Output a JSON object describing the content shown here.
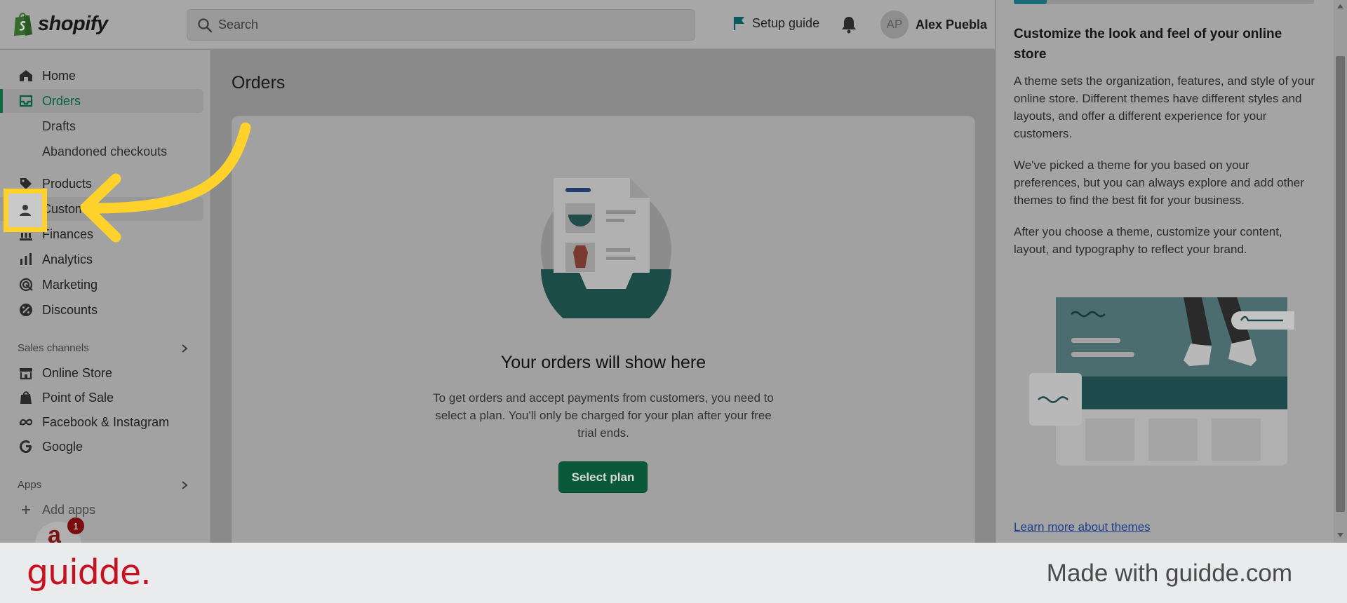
{
  "topbar": {
    "brand": "shopify",
    "search_placeholder": "Search",
    "setup_guide": "Setup guide",
    "avatar_initials": "AP",
    "user_name": "Alex Puebla"
  },
  "sidebar": {
    "items": [
      {
        "label": "Home",
        "icon": "home-icon"
      },
      {
        "label": "Orders",
        "icon": "inbox-icon",
        "active": true
      },
      {
        "label": "Drafts",
        "sub": true
      },
      {
        "label": "Abandoned checkouts",
        "sub": true
      },
      {
        "label": "Products",
        "icon": "tag-icon"
      },
      {
        "label": "Customers",
        "icon": "person-icon"
      },
      {
        "label": "Finances",
        "icon": "bank-icon"
      },
      {
        "label": "Analytics",
        "icon": "bar-chart-icon"
      },
      {
        "label": "Marketing",
        "icon": "target-icon"
      },
      {
        "label": "Discounts",
        "icon": "discount-icon"
      }
    ],
    "sales_channels_header": "Sales channels",
    "channels": [
      {
        "label": "Online Store",
        "icon": "store-icon"
      },
      {
        "label": "Point of Sale",
        "icon": "pos-bag-icon"
      },
      {
        "label": "Facebook & Instagram",
        "icon": "meta-icon"
      },
      {
        "label": "Google",
        "icon": "google-icon"
      }
    ],
    "apps_header": "Apps",
    "add_apps": "Add apps"
  },
  "main": {
    "title": "Orders",
    "empty_title": "Your orders will show here",
    "empty_desc": "To get orders and accept payments from customers, you need to select a plan. You'll only be charged for your plan after your free trial ends.",
    "select_plan": "Select plan"
  },
  "right_panel": {
    "progress_fraction": 0.11,
    "title": "Customize the look and feel of your online store",
    "p1": "A theme sets the organization, features, and style of your online store. Different themes have different styles and layouts, and offer a different experience for your customers.",
    "p2": "We've picked a theme for you based on your preferences, but you can always explore and add other themes to find the best fit for your business.",
    "p3": "After you choose a theme, customize your content, layout, and typography to reflect your brand.",
    "link": "Learn more about themes"
  },
  "chat": {
    "badge": "1"
  },
  "footer": {
    "logo": "guidde.",
    "made_with": "Made with guidde.com"
  },
  "colors": {
    "accent_green": "#0b6b45",
    "highlight_yellow": "#ffd12b",
    "guidde_red": "#c8101e"
  }
}
